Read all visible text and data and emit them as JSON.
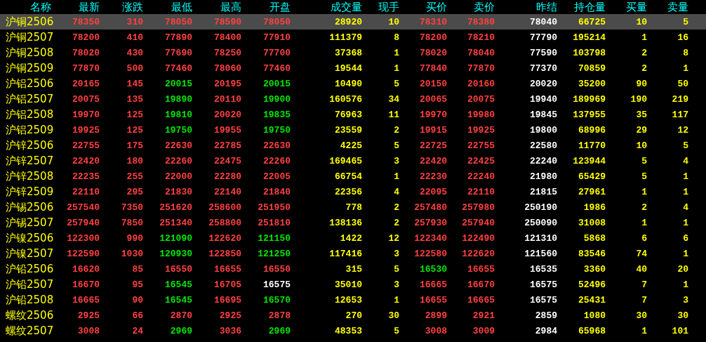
{
  "table": {
    "columns": [
      {
        "label": "名称",
        "kind": "name"
      },
      {
        "label": "最新",
        "kind": "price"
      },
      {
        "label": "涨跌",
        "kind": "price"
      },
      {
        "label": "最低",
        "kind": "price"
      },
      {
        "label": "最高",
        "kind": "price"
      },
      {
        "label": "开盘",
        "kind": "price"
      },
      {
        "label": "成交量",
        "kind": "volume"
      },
      {
        "label": "现手",
        "kind": "volume"
      },
      {
        "label": "买价",
        "kind": "price"
      },
      {
        "label": "卖价",
        "kind": "price"
      },
      {
        "label": "昨结",
        "kind": "settle"
      },
      {
        "label": "持仓量",
        "kind": "volume"
      },
      {
        "label": "买量",
        "kind": "volume"
      },
      {
        "label": "卖量",
        "kind": "volume"
      }
    ],
    "rows": [
      {
        "selected": true,
        "cells": [
          "沪铜2506",
          {
            "text": "78350",
            "color": "#ff4040"
          },
          {
            "text": "310",
            "color": "#ff4040"
          },
          {
            "text": "78050",
            "color": "#ff4040"
          },
          {
            "text": "78590",
            "color": "#ff4040"
          },
          {
            "text": "78050",
            "color": "#ff4040"
          },
          "28920",
          "10",
          {
            "text": "78310",
            "color": "#ff4040"
          },
          {
            "text": "78380",
            "color": "#ff4040"
          },
          "78040",
          "66725",
          "10",
          "5"
        ]
      },
      {
        "selected": false,
        "cells": [
          "沪铜2507",
          {
            "text": "78200",
            "color": "#ff4040"
          },
          {
            "text": "410",
            "color": "#ff4040"
          },
          {
            "text": "77890",
            "color": "#ff4040"
          },
          {
            "text": "78400",
            "color": "#ff4040"
          },
          {
            "text": "77910",
            "color": "#ff4040"
          },
          "111379",
          "8",
          {
            "text": "78200",
            "color": "#ff4040"
          },
          {
            "text": "78210",
            "color": "#ff4040"
          },
          "77790",
          "195214",
          "1",
          "16"
        ]
      },
      {
        "selected": false,
        "cells": [
          "沪铜2508",
          {
            "text": "78020",
            "color": "#ff4040"
          },
          {
            "text": "430",
            "color": "#ff4040"
          },
          {
            "text": "77690",
            "color": "#ff4040"
          },
          {
            "text": "78250",
            "color": "#ff4040"
          },
          {
            "text": "77700",
            "color": "#ff4040"
          },
          "37368",
          "1",
          {
            "text": "78020",
            "color": "#ff4040"
          },
          {
            "text": "78040",
            "color": "#ff4040"
          },
          "77590",
          "103798",
          "2",
          "8"
        ]
      },
      {
        "selected": false,
        "cells": [
          "沪铜2509",
          {
            "text": "77870",
            "color": "#ff4040"
          },
          {
            "text": "500",
            "color": "#ff4040"
          },
          {
            "text": "77460",
            "color": "#ff4040"
          },
          {
            "text": "78060",
            "color": "#ff4040"
          },
          {
            "text": "77460",
            "color": "#ff4040"
          },
          "19544",
          "1",
          {
            "text": "77840",
            "color": "#ff4040"
          },
          {
            "text": "77870",
            "color": "#ff4040"
          },
          "77370",
          "70859",
          "2",
          "1"
        ]
      },
      {
        "selected": false,
        "cells": [
          "沪铝2506",
          {
            "text": "20165",
            "color": "#ff4040"
          },
          {
            "text": "145",
            "color": "#ff4040"
          },
          {
            "text": "20015",
            "color": "#00e600"
          },
          {
            "text": "20195",
            "color": "#ff4040"
          },
          {
            "text": "20015",
            "color": "#00e600"
          },
          "10490",
          "5",
          {
            "text": "20150",
            "color": "#ff4040"
          },
          {
            "text": "20160",
            "color": "#ff4040"
          },
          "20020",
          "35200",
          "90",
          "50"
        ]
      },
      {
        "selected": false,
        "cells": [
          "沪铝2507",
          {
            "text": "20075",
            "color": "#ff4040"
          },
          {
            "text": "135",
            "color": "#ff4040"
          },
          {
            "text": "19890",
            "color": "#00e600"
          },
          {
            "text": "20110",
            "color": "#ff4040"
          },
          {
            "text": "19900",
            "color": "#00e600"
          },
          "160576",
          "34",
          {
            "text": "20065",
            "color": "#ff4040"
          },
          {
            "text": "20075",
            "color": "#ff4040"
          },
          "19940",
          "189969",
          "190",
          "219"
        ]
      },
      {
        "selected": false,
        "cells": [
          "沪铝2508",
          {
            "text": "19970",
            "color": "#ff4040"
          },
          {
            "text": "125",
            "color": "#ff4040"
          },
          {
            "text": "19810",
            "color": "#00e600"
          },
          {
            "text": "20020",
            "color": "#ff4040"
          },
          {
            "text": "19835",
            "color": "#00e600"
          },
          "76963",
          "11",
          {
            "text": "19970",
            "color": "#ff4040"
          },
          {
            "text": "19980",
            "color": "#ff4040"
          },
          "19845",
          "137955",
          "35",
          "117"
        ]
      },
      {
        "selected": false,
        "cells": [
          "沪铝2509",
          {
            "text": "19925",
            "color": "#ff4040"
          },
          {
            "text": "125",
            "color": "#ff4040"
          },
          {
            "text": "19750",
            "color": "#00e600"
          },
          {
            "text": "19955",
            "color": "#ff4040"
          },
          {
            "text": "19750",
            "color": "#00e600"
          },
          "23559",
          "2",
          {
            "text": "19915",
            "color": "#ff4040"
          },
          {
            "text": "19925",
            "color": "#ff4040"
          },
          "19800",
          "68996",
          "29",
          "12"
        ]
      },
      {
        "selected": false,
        "cells": [
          "沪锌2506",
          {
            "text": "22755",
            "color": "#ff4040"
          },
          {
            "text": "175",
            "color": "#ff4040"
          },
          {
            "text": "22630",
            "color": "#ff4040"
          },
          {
            "text": "22785",
            "color": "#ff4040"
          },
          {
            "text": "22630",
            "color": "#ff4040"
          },
          "4225",
          "5",
          {
            "text": "22725",
            "color": "#ff4040"
          },
          {
            "text": "22755",
            "color": "#ff4040"
          },
          "22580",
          "11770",
          "10",
          "5"
        ]
      },
      {
        "selected": false,
        "cells": [
          "沪锌2507",
          {
            "text": "22420",
            "color": "#ff4040"
          },
          {
            "text": "180",
            "color": "#ff4040"
          },
          {
            "text": "22260",
            "color": "#ff4040"
          },
          {
            "text": "22475",
            "color": "#ff4040"
          },
          {
            "text": "22260",
            "color": "#ff4040"
          },
          "169465",
          "3",
          {
            "text": "22420",
            "color": "#ff4040"
          },
          {
            "text": "22425",
            "color": "#ff4040"
          },
          "22240",
          "123944",
          "5",
          "4"
        ]
      },
      {
        "selected": false,
        "cells": [
          "沪锌2508",
          {
            "text": "22235",
            "color": "#ff4040"
          },
          {
            "text": "255",
            "color": "#ff4040"
          },
          {
            "text": "22000",
            "color": "#ff4040"
          },
          {
            "text": "22280",
            "color": "#ff4040"
          },
          {
            "text": "22005",
            "color": "#ff4040"
          },
          "66754",
          "1",
          {
            "text": "22230",
            "color": "#ff4040"
          },
          {
            "text": "22240",
            "color": "#ff4040"
          },
          "21980",
          "65429",
          "5",
          "1"
        ]
      },
      {
        "selected": false,
        "cells": [
          "沪锌2509",
          {
            "text": "22110",
            "color": "#ff4040"
          },
          {
            "text": "295",
            "color": "#ff4040"
          },
          {
            "text": "21830",
            "color": "#ff4040"
          },
          {
            "text": "22140",
            "color": "#ff4040"
          },
          {
            "text": "21840",
            "color": "#ff4040"
          },
          "22356",
          "4",
          {
            "text": "22095",
            "color": "#ff4040"
          },
          {
            "text": "22110",
            "color": "#ff4040"
          },
          "21815",
          "27961",
          "1",
          "1"
        ]
      },
      {
        "selected": false,
        "cells": [
          "沪锡2506",
          {
            "text": "257540",
            "color": "#ff4040"
          },
          {
            "text": "7350",
            "color": "#ff4040"
          },
          {
            "text": "251620",
            "color": "#ff4040"
          },
          {
            "text": "258600",
            "color": "#ff4040"
          },
          {
            "text": "251950",
            "color": "#ff4040"
          },
          "778",
          "2",
          {
            "text": "257480",
            "color": "#ff4040"
          },
          {
            "text": "257980",
            "color": "#ff4040"
          },
          "250190",
          "1986",
          "2",
          "4"
        ]
      },
      {
        "selected": false,
        "cells": [
          "沪锡2507",
          {
            "text": "257940",
            "color": "#ff4040"
          },
          {
            "text": "7850",
            "color": "#ff4040"
          },
          {
            "text": "251340",
            "color": "#ff4040"
          },
          {
            "text": "258800",
            "color": "#ff4040"
          },
          {
            "text": "251810",
            "color": "#ff4040"
          },
          "138136",
          "2",
          {
            "text": "257930",
            "color": "#ff4040"
          },
          {
            "text": "257940",
            "color": "#ff4040"
          },
          "250090",
          "31008",
          "1",
          "1"
        ]
      },
      {
        "selected": false,
        "cells": [
          "沪镍2506",
          {
            "text": "122300",
            "color": "#ff4040"
          },
          {
            "text": "990",
            "color": "#ff4040"
          },
          {
            "text": "121090",
            "color": "#00e600"
          },
          {
            "text": "122620",
            "color": "#ff4040"
          },
          {
            "text": "121150",
            "color": "#00e600"
          },
          "1422",
          "12",
          {
            "text": "122340",
            "color": "#ff4040"
          },
          {
            "text": "122490",
            "color": "#ff4040"
          },
          "121310",
          "5868",
          "6",
          "6"
        ]
      },
      {
        "selected": false,
        "cells": [
          "沪镍2507",
          {
            "text": "122590",
            "color": "#ff4040"
          },
          {
            "text": "1030",
            "color": "#ff4040"
          },
          {
            "text": "120930",
            "color": "#00e600"
          },
          {
            "text": "122850",
            "color": "#ff4040"
          },
          {
            "text": "121250",
            "color": "#00e600"
          },
          "117416",
          "3",
          {
            "text": "122580",
            "color": "#ff4040"
          },
          {
            "text": "122620",
            "color": "#ff4040"
          },
          "121560",
          "83546",
          "74",
          "1"
        ]
      },
      {
        "selected": false,
        "cells": [
          "沪铅2506",
          {
            "text": "16620",
            "color": "#ff4040"
          },
          {
            "text": "85",
            "color": "#ff4040"
          },
          {
            "text": "16550",
            "color": "#ff4040"
          },
          {
            "text": "16655",
            "color": "#ff4040"
          },
          {
            "text": "16550",
            "color": "#ff4040"
          },
          "315",
          "5",
          {
            "text": "16530",
            "color": "#00e600"
          },
          {
            "text": "16655",
            "color": "#ff4040"
          },
          "16535",
          "3360",
          "40",
          "20"
        ]
      },
      {
        "selected": false,
        "cells": [
          "沪铅2507",
          {
            "text": "16670",
            "color": "#ff4040"
          },
          {
            "text": "95",
            "color": "#ff4040"
          },
          {
            "text": "16545",
            "color": "#00e600"
          },
          {
            "text": "16705",
            "color": "#ff4040"
          },
          {
            "text": "16575",
            "color": "#ffffff"
          },
          "35010",
          "3",
          {
            "text": "16665",
            "color": "#ff4040"
          },
          {
            "text": "16670",
            "color": "#ff4040"
          },
          "16575",
          "52496",
          "7",
          "1"
        ]
      },
      {
        "selected": false,
        "cells": [
          "沪铅2508",
          {
            "text": "16665",
            "color": "#ff4040"
          },
          {
            "text": "90",
            "color": "#ff4040"
          },
          {
            "text": "16545",
            "color": "#00e600"
          },
          {
            "text": "16695",
            "color": "#ff4040"
          },
          {
            "text": "16570",
            "color": "#00e600"
          },
          "12653",
          "1",
          {
            "text": "16655",
            "color": "#ff4040"
          },
          {
            "text": "16665",
            "color": "#ff4040"
          },
          "16575",
          "25431",
          "7",
          "3"
        ]
      },
      {
        "selected": false,
        "cells": [
          "螺纹2506",
          {
            "text": "2925",
            "color": "#ff4040"
          },
          {
            "text": "66",
            "color": "#ff4040"
          },
          {
            "text": "2870",
            "color": "#ff4040"
          },
          {
            "text": "2925",
            "color": "#ff4040"
          },
          {
            "text": "2878",
            "color": "#ff4040"
          },
          "270",
          "30",
          {
            "text": "2899",
            "color": "#ff4040"
          },
          {
            "text": "2921",
            "color": "#ff4040"
          },
          "2859",
          "1080",
          "30",
          "30"
        ]
      },
      {
        "selected": false,
        "cells": [
          "螺纹2507",
          {
            "text": "3008",
            "color": "#ff4040"
          },
          {
            "text": "24",
            "color": "#ff4040"
          },
          {
            "text": "2969",
            "color": "#00e600"
          },
          {
            "text": "3036",
            "color": "#ff4040"
          },
          {
            "text": "2969",
            "color": "#00e600"
          },
          "48353",
          "5",
          {
            "text": "3008",
            "color": "#ff4040"
          },
          {
            "text": "3009",
            "color": "#ff4040"
          },
          "2984",
          "65968",
          "1",
          "101"
        ]
      }
    ]
  }
}
